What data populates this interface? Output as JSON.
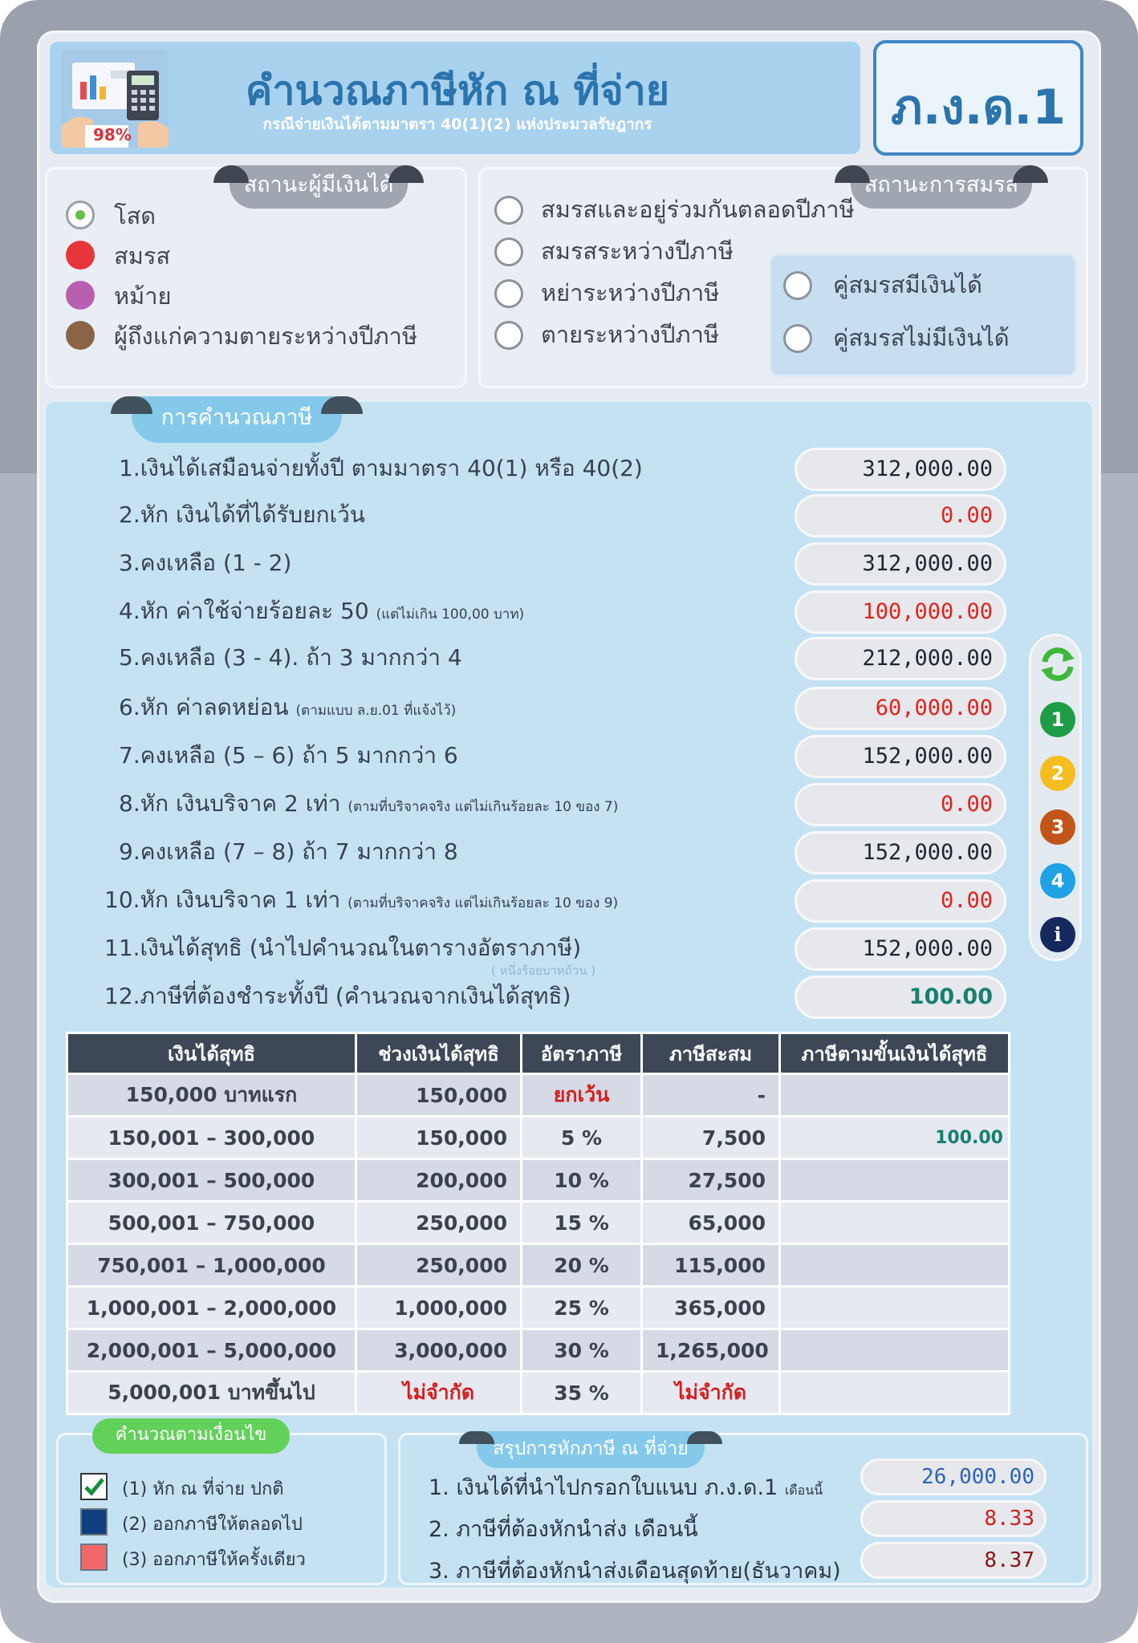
{
  "header": {
    "title": "คำนวณภาษีหัก ณ ที่จ่าย",
    "subtitle": "กรณีจ่ายเงินได้ตามมาตรา 40(1)(2) แห่งประมวลรัษฎากร",
    "form_name": "ภ.ง.ด.1",
    "logo_percent": "98%"
  },
  "payee_status": {
    "tab": "สถานะผู้มีเงินได้",
    "options": [
      {
        "label": "โสด",
        "color": "#67bd45",
        "selected": true
      },
      {
        "label": "สมรส",
        "color": "#e8343b",
        "selected": false
      },
      {
        "label": "หม้าย",
        "color": "#b85fb0",
        "selected": false
      },
      {
        "label": "ผู้ถึงแก่ความตายระหว่างปีภาษี",
        "color": "#8a6446",
        "selected": false
      }
    ]
  },
  "marital_status": {
    "tab": "สถานะการสมรส",
    "options": [
      {
        "label": "สมรสและอยู่ร่วมกันตลอดปีภาษี"
      },
      {
        "label": "สมรสระหว่างปีภาษี"
      },
      {
        "label": "หย่าระหว่างปีภาษี"
      },
      {
        "label": "ตายระหว่างปีภาษี"
      }
    ],
    "spouse_options": [
      {
        "label": "คู่สมรสมีเงินได้"
      },
      {
        "label": "คู่สมรสไม่มีเงินได้"
      }
    ]
  },
  "calculation": {
    "tab": "การคำนวณภาษี",
    "note": "( หนึ่งร้อยบาทถ้วน )",
    "lines": [
      {
        "label": "1.เงินได้เสมือนจ่ายทั้งปี ตามมาตรา 40(1) หรือ 40(2)",
        "hint": "",
        "value": "312,000.00",
        "color": "#1f2630"
      },
      {
        "label": "2.หัก เงินได้ที่ได้รับยกเว้น",
        "hint": "",
        "value": "0.00",
        "color": "#e2231d"
      },
      {
        "label": "3.คงเหลือ (1 - 2)",
        "hint": "",
        "value": "312,000.00",
        "color": "#1f2630"
      },
      {
        "label": "4.หัก ค่าใช้จ่ายร้อยละ 50",
        "hint": "(แต่ไม่เกิน 100,00 บาท)",
        "value": "100,000.00",
        "color": "#e2231d"
      },
      {
        "label": "5.คงเหลือ (3 - 4).  ถ้า 3 มากกว่า 4",
        "hint": "",
        "value": "212,000.00",
        "color": "#1f2630"
      },
      {
        "label": "6.หัก ค่าลดหย่อน",
        "hint": "(ตามแบบ ล.ย.01 ที่แจ้งไว้)",
        "value": "60,000.00",
        "color": "#e2231d"
      },
      {
        "label": "7.คงเหลือ (5 – 6) ถ้า 5 มากกว่า 6",
        "hint": "",
        "value": "152,000.00",
        "color": "#1f2630"
      },
      {
        "label": "8.หัก เงินบริจาค 2 เท่า",
        "hint": "(ตามที่บริจาคจริง แต่ไม่เกินร้อยละ 10 ของ 7)",
        "value": "0.00",
        "color": "#e2231d"
      },
      {
        "label": "9.คงเหลือ (7 – 8) ถ้า 7 มากกว่า 8",
        "hint": "",
        "value": "152,000.00",
        "color": "#1f2630"
      },
      {
        "label": "10.หัก เงินบริจาค 1 เท่า",
        "hint": "(ตามที่บริจาคจริง แต่ไม่เกินร้อยละ 10 ของ 9)",
        "value": "0.00",
        "color": "#e2231d"
      },
      {
        "label": "11.เงินได้สุทธิ (นำไปคำนวณในตารางอัตราภาษี)",
        "hint": "",
        "value": "152,000.00",
        "color": "#1f2630"
      },
      {
        "label": "12.ภาษีที่ต้องชำระทั้งปี (คำนวณจากเงินได้สุทธิ)",
        "hint": "",
        "value": "100.00",
        "color": "#17806e"
      }
    ]
  },
  "side_buttons": [
    {
      "label": "1",
      "color": "#1f9c46"
    },
    {
      "label": "2",
      "color": "#f5bd1f"
    },
    {
      "label": "3",
      "color": "#c2541a"
    },
    {
      "label": "4",
      "color": "#1ea2e3"
    },
    {
      "label": "i",
      "color": "#15295f"
    }
  ],
  "tax_table": {
    "headers": [
      "เงินได้สุทธิ",
      "ช่วงเงินได้สุทธิ",
      "อัตราภาษี",
      "ภาษีสะสม",
      "ภาษีตามขั้นเงินได้สุทธิ"
    ],
    "rows": [
      [
        "150,000 บาทแรก",
        "150,000",
        "ยกเว้น",
        "-",
        ""
      ],
      [
        "150,001 – 300,000",
        "150,000",
        "5 %",
        "7,500",
        "100.00"
      ],
      [
        "300,001 – 500,000",
        "200,000",
        "10 %",
        "27,500",
        ""
      ],
      [
        "500,001 – 750,000",
        "250,000",
        "15 %",
        "65,000",
        ""
      ],
      [
        "750,001 – 1,000,000",
        "250,000",
        "20 %",
        "115,000",
        ""
      ],
      [
        "1,000,001 – 2,000,000",
        "1,000,000",
        "25 %",
        "365,000",
        ""
      ],
      [
        "2,000,001 – 5,000,000",
        "3,000,000",
        "30 %",
        "1,265,000",
        ""
      ],
      [
        "5,000,001 บาทขึ้นไป",
        "ไม่จำกัด",
        "35 %",
        "ไม่จำกัด",
        ""
      ]
    ]
  },
  "conditions": {
    "tab": "คำนวณตามเงื่อนไข",
    "options": [
      {
        "label": "(1) หัก ณ ที่จ่าย ปกติ",
        "checked": true,
        "color": "#ffffff"
      },
      {
        "label": "(2) ออกภาษีให้ตลอดไป",
        "checked": false,
        "color": "#0f3f7e"
      },
      {
        "label": "(3) ออกภาษีให้ครั้งเดียว",
        "checked": false,
        "color": "#f0686a"
      }
    ]
  },
  "summary": {
    "tab": "สรุปการหักภาษี ณ ที่จ่าย",
    "lines": [
      {
        "label": "1. เงินได้ที่นำไปกรอกใบแนบ ภ.ง.ด.1",
        "hint": "เดือนนี้",
        "value": "26,000.00",
        "color": "#2b63b8"
      },
      {
        "label": "2. ภาษีที่ต้องหักนำส่ง เดือนนี้",
        "hint": "",
        "value": "8.33",
        "color": "#d01d1d"
      },
      {
        "label": "3. ภาษีที่ต้องหักนำส่งเดือนสุดท้าย(ธันวาคม)",
        "hint": "",
        "value": "8.37",
        "color": "#8a1414"
      }
    ]
  }
}
